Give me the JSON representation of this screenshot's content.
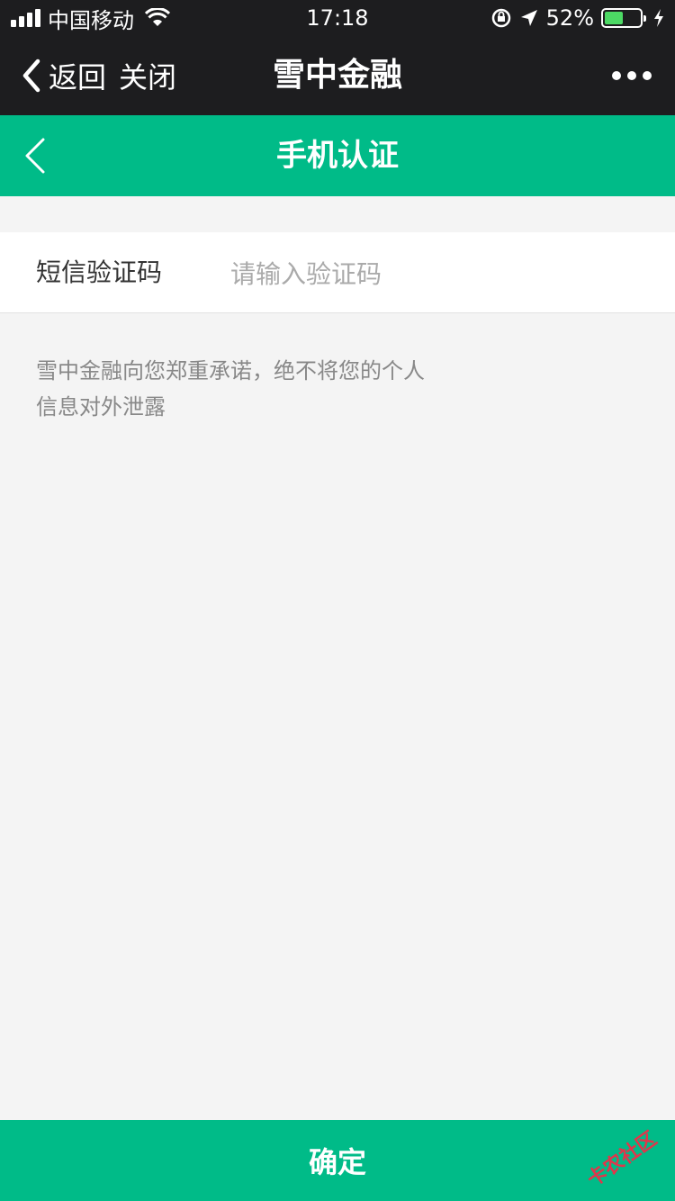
{
  "status_bar": {
    "carrier": "中国移动",
    "time": "17:18",
    "battery_percent": "52%",
    "battery_level": 0.52,
    "icons": [
      "signal-icon",
      "wifi-icon",
      "orientation-lock-icon",
      "location-icon",
      "battery-icon",
      "charging-icon"
    ]
  },
  "nav": {
    "back_label": "返回",
    "close_label": "关闭",
    "title": "雪中金融"
  },
  "header": {
    "title": "手机认证"
  },
  "form": {
    "label": "短信验证码",
    "placeholder": "请输入验证码",
    "value": ""
  },
  "notice": {
    "text": "雪中金融向您郑重承诺，绝不将您的个人信息对外泄露"
  },
  "footer": {
    "confirm_label": "确定"
  },
  "watermark": {
    "text": "卡农社区"
  },
  "colors": {
    "accent": "#00bb88",
    "dark_bar": "#1d1d1f",
    "background": "#f4f4f4"
  }
}
